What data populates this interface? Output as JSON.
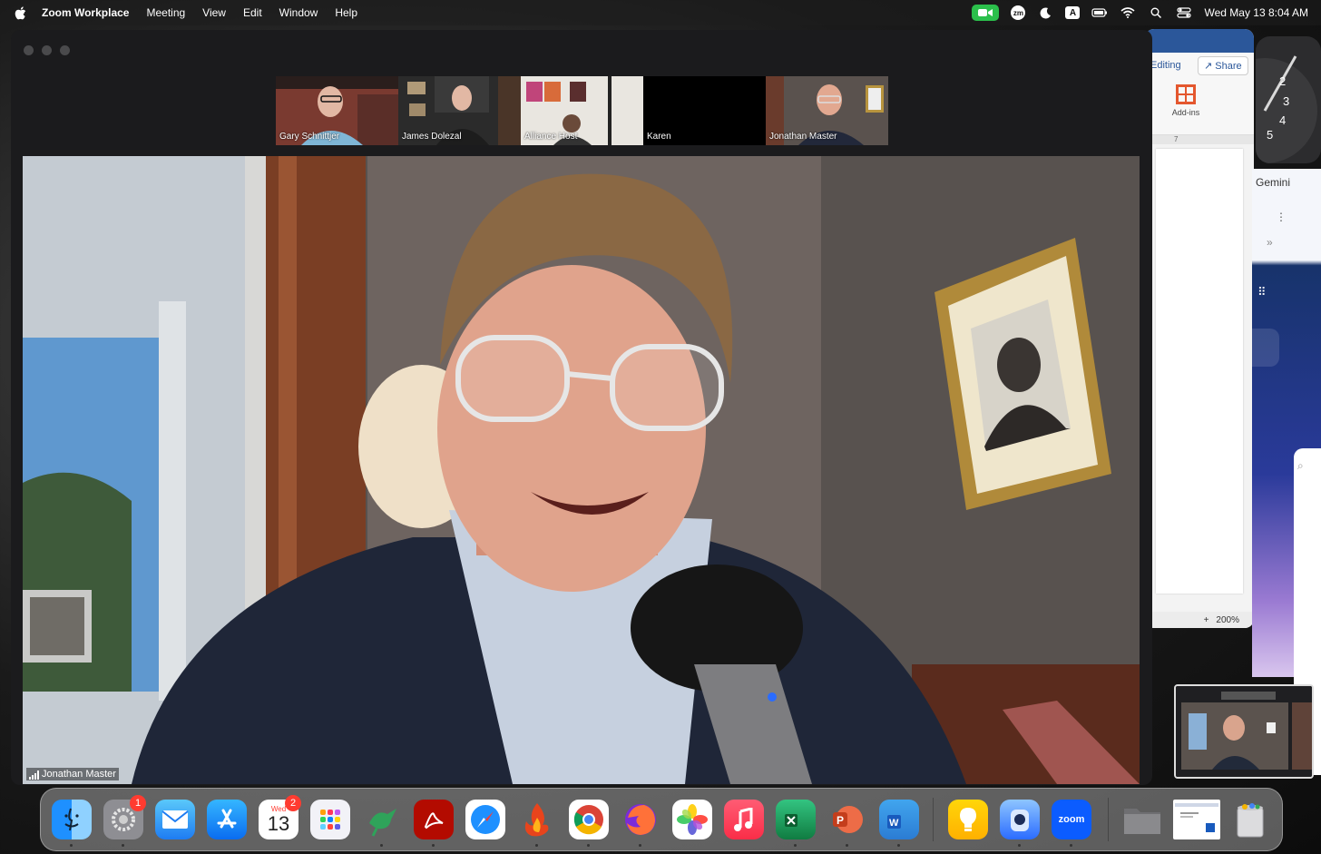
{
  "menubar": {
    "app_name": "Zoom Workplace",
    "items": [
      "Meeting",
      "View",
      "Edit",
      "Window",
      "Help"
    ],
    "zm_badge": "zm",
    "input_badge": "A",
    "datetime": "Wed May 13  8:04 AM",
    "icons": [
      "zoom-camera-icon",
      "zm-icon",
      "moon-icon",
      "input-source-icon",
      "battery-icon",
      "wifi-icon",
      "search-icon",
      "control-center-icon"
    ]
  },
  "word": {
    "editing": "Editing",
    "share": "Share",
    "addins": "Add-ins",
    "ruler_mark": "7",
    "zoom_level": "200%",
    "plus": "+"
  },
  "clock_widget": {
    "numbers": [
      "2",
      "3",
      "4",
      "5"
    ]
  },
  "gemini": {
    "label": "Gemini"
  },
  "zoom": {
    "participants": [
      {
        "name": "Gary Schnittjer"
      },
      {
        "name": "James Dolezal"
      },
      {
        "name": "Alliance Host"
      },
      {
        "name": "Karen"
      },
      {
        "name": "Jonathan Master"
      }
    ],
    "active_speaker_index": 4,
    "main_speaker": "Jonathan Master"
  },
  "dock": {
    "calendar_day": "Wed",
    "calendar_date": "13",
    "settings_badge": "1",
    "calendar_badge": "2",
    "zoom_label": "zoom",
    "icons": [
      "finder-icon",
      "system-settings-icon",
      "mail-icon",
      "app-store-icon",
      "calendar-icon",
      "launchpad-icon",
      "bird-app-icon",
      "acrobat-icon",
      "safari-icon",
      "fire-app-icon",
      "chrome-icon",
      "firefox-icon",
      "photos-icon",
      "music-icon",
      "excel-icon",
      "powerpoint-icon",
      "word-icon",
      "tips-icon",
      "lens-app-icon",
      "zoom-icon",
      "downloads-folder-icon",
      "window-preview-icon",
      "trash-icon"
    ]
  },
  "colors": {
    "active_outline": "#3cd04f",
    "zoom_blue": "#0b5cff",
    "badge_red": "#ff3b30",
    "word_blue": "#2b579a"
  }
}
